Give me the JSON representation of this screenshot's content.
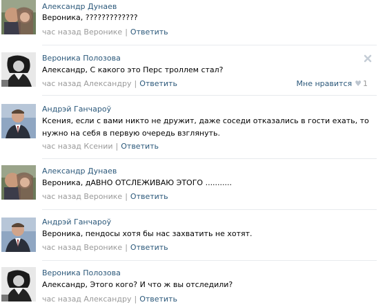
{
  "comments": [
    {
      "author": "Александр Дунаев",
      "text": "Вероника, ?????????????",
      "time": "час назад Веронике",
      "reply": "Ответить",
      "avatar": "couple-photo"
    },
    {
      "author": "Вероника Полозова",
      "text": "Александр, С какого это Перс троллем стал?",
      "time": "час назад Александру",
      "reply": "Ответить",
      "avatar": "bw-portrait",
      "like_label": "Мне нравится",
      "like_count": "1"
    },
    {
      "author": "Андрэй Ганчароў",
      "text": "Ксения, если с вами никто не дружит, даже соседи отказались в гости ехать, то нужно на себя в первую очередь взглянуть.",
      "time": "час назад Ксении",
      "reply": "Ответить",
      "avatar": "man-portrait"
    },
    {
      "author": "Александр Дунаев",
      "text": "Вероника, дАВНО ОТСЛЕЖИВАЮ ЭТОГО ...........",
      "time": "час назад Веронике",
      "reply": "Ответить",
      "avatar": "couple-photo"
    },
    {
      "author": "Андрэй Ганчароў",
      "text": "Вероника, пендосы хотя бы нас захватить не хотят.",
      "time": "час назад Веронике",
      "reply": "Ответить",
      "avatar": "man-portrait"
    },
    {
      "author": "Вероника Полозова",
      "text": "Александр, Этого кого? И что ж вы отследили?",
      "time": "час назад Александру",
      "reply": "Ответить",
      "avatar": "bw-portrait"
    }
  ],
  "colors": {
    "link": "#2b587a",
    "meta": "#999999",
    "divider": "#e7eaed"
  },
  "icons": {
    "delete": "close-icon",
    "like": "heart-icon"
  }
}
